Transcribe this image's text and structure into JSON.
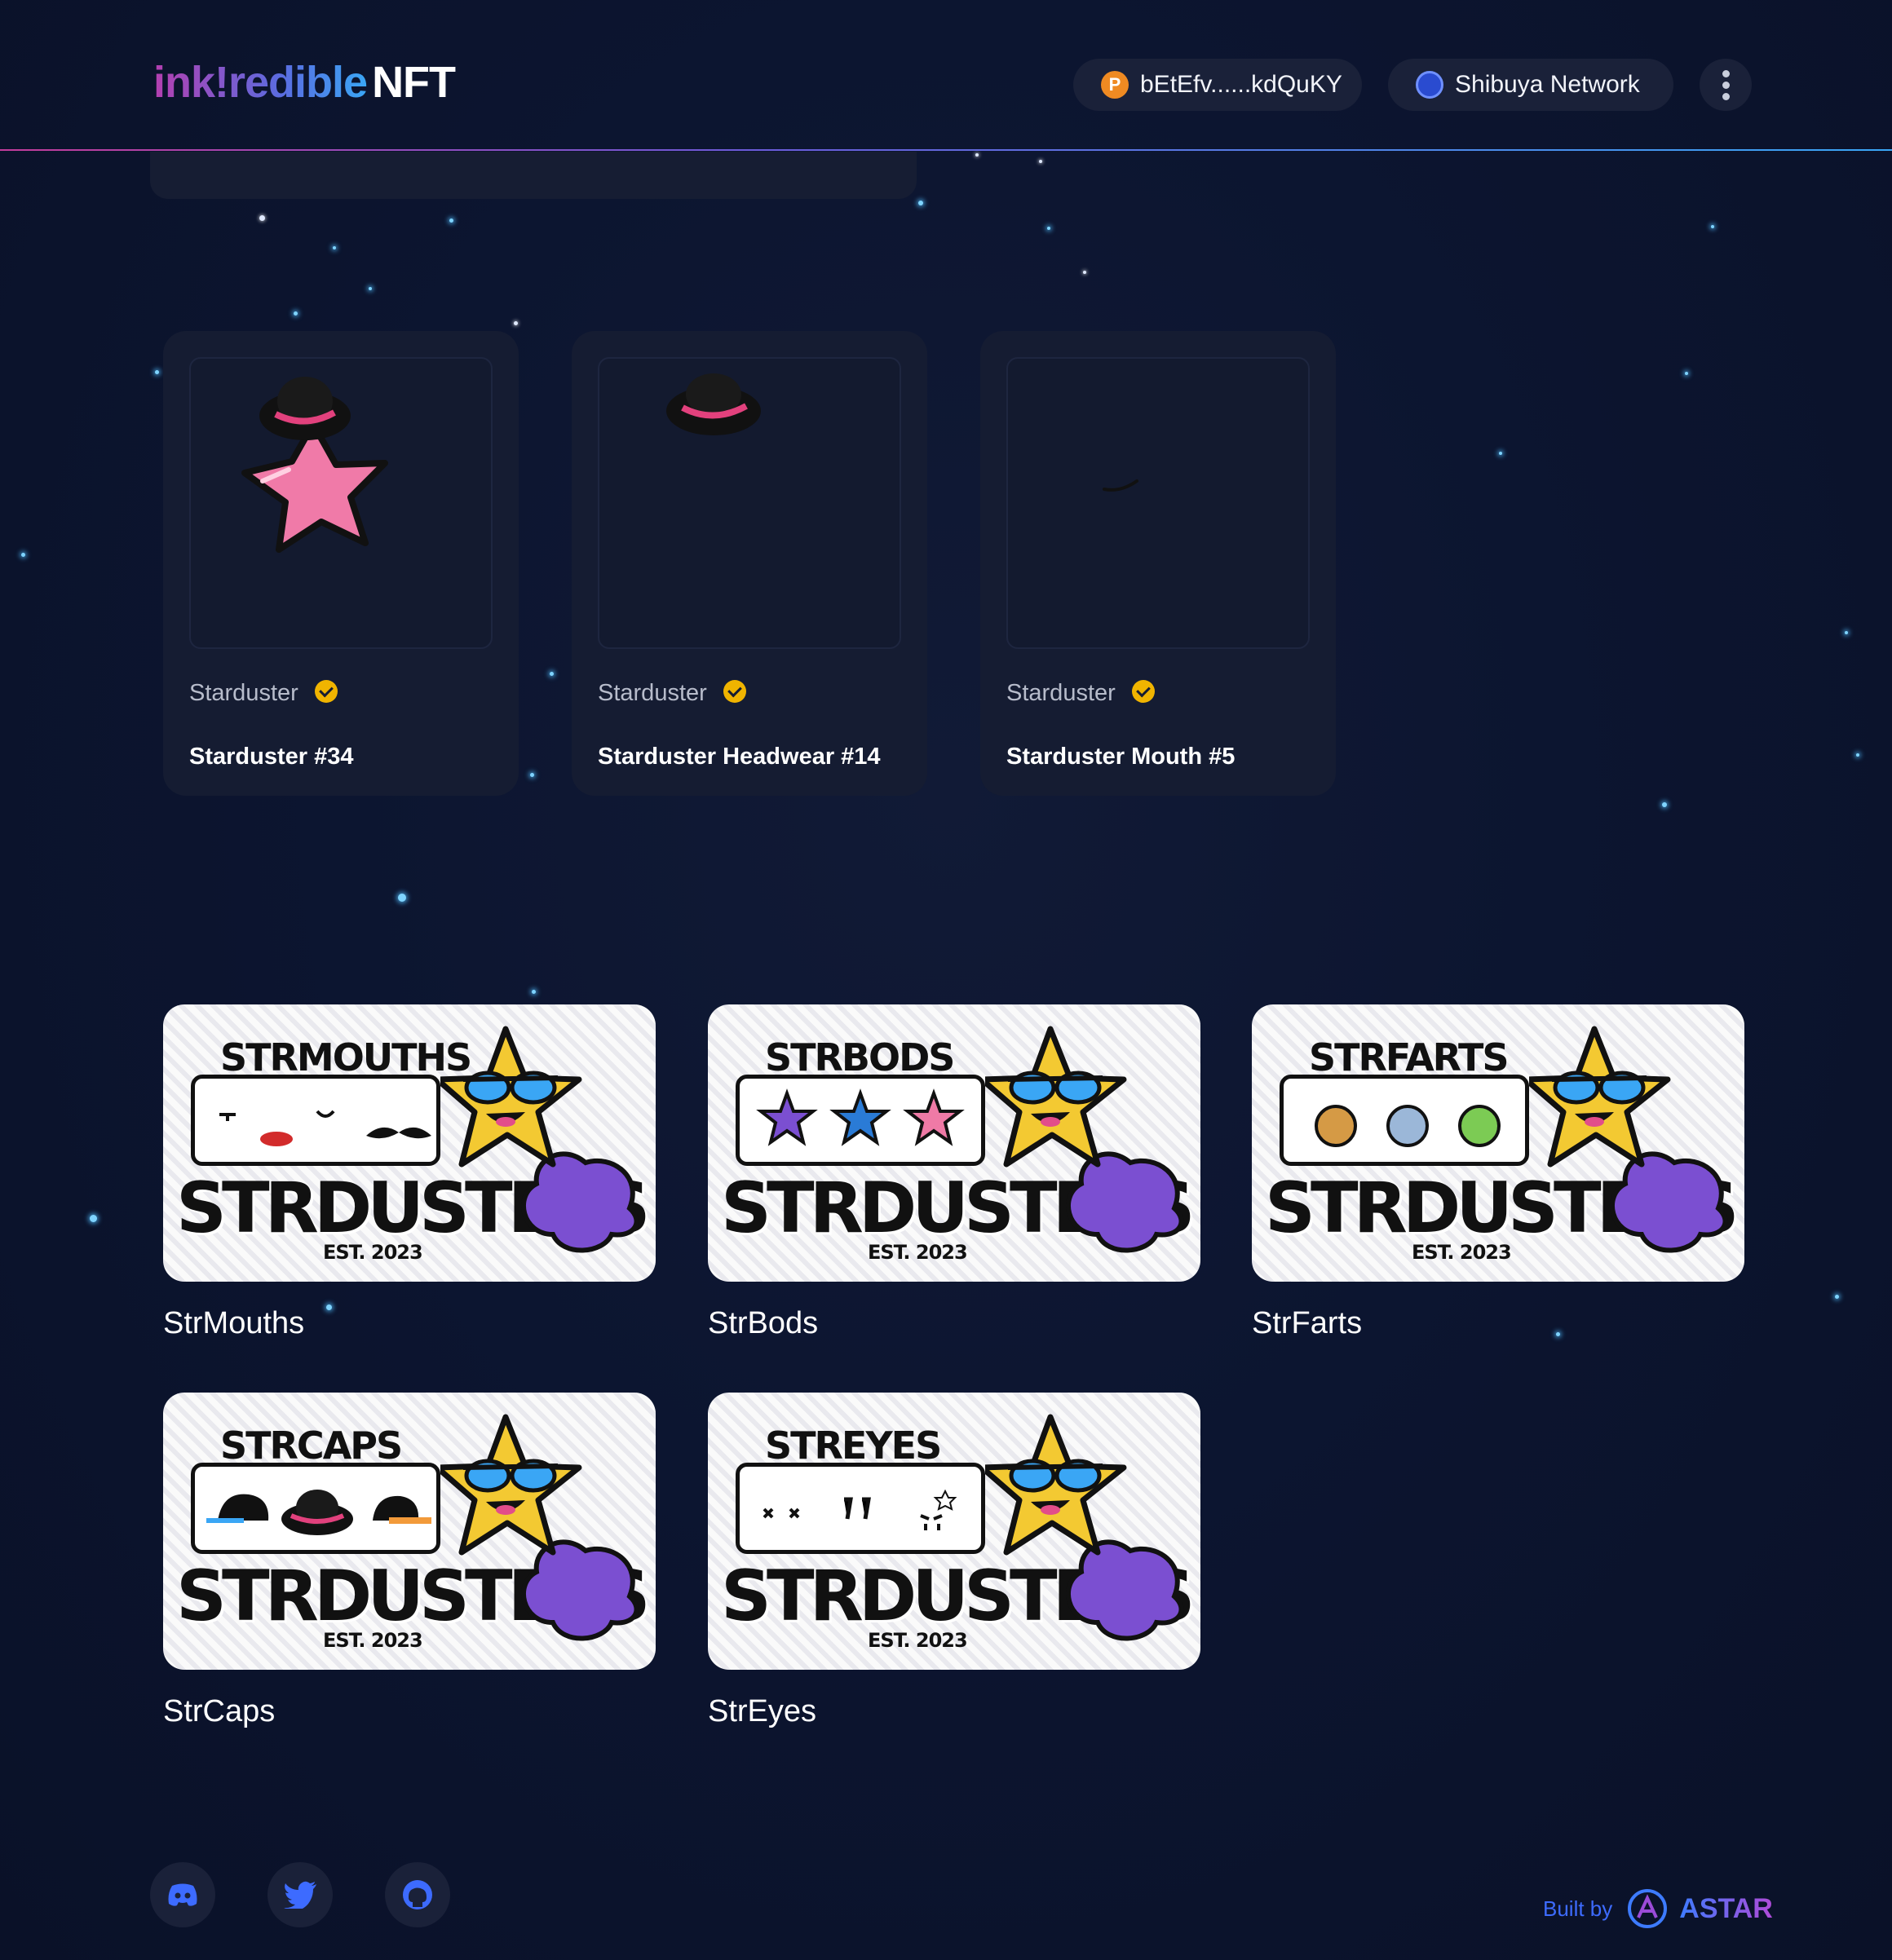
{
  "header": {
    "logo_part1": "ink!redible",
    "logo_part2": "NFT",
    "account": "bEtEfv......kdQuKY",
    "account_icon": "polkadot-icon",
    "network": "Shibuya Network",
    "network_icon": "shibuya-icon",
    "menu_icon": "more-vertical-icon"
  },
  "nfts": [
    {
      "collection": "Starduster",
      "name": "Starduster #34",
      "image": "pink-star-with-hat"
    },
    {
      "collection": "Starduster",
      "name": "Starduster Headwear #14",
      "image": "black-hat"
    },
    {
      "collection": "Starduster",
      "name": "Starduster Mouth #5",
      "image": "mouth-line"
    }
  ],
  "collections": [
    {
      "name": "StrMouths",
      "banner_title": "STRMOUTHS",
      "banner_brand": "STRDUSTERS",
      "banner_est": "EST. 2023"
    },
    {
      "name": "StrBods",
      "banner_title": "STRBODS",
      "banner_brand": "STRDUSTERS",
      "banner_est": "EST. 2023"
    },
    {
      "name": "StrFarts",
      "banner_title": "STRFARTS",
      "banner_brand": "STRDUSTERS",
      "banner_est": "EST. 2023"
    },
    {
      "name": "StrCaps",
      "banner_title": "STRCAPS",
      "banner_brand": "STRDUSTERS",
      "banner_est": "EST. 2023"
    },
    {
      "name": "StrEyes",
      "banner_title": "STREYES",
      "banner_brand": "STRDUSTERS",
      "banner_est": "EST. 2023"
    }
  ],
  "footer": {
    "social": [
      "discord-icon",
      "twitter-icon",
      "github-icon"
    ],
    "built_by": "Built by",
    "brand": "ASTAR"
  },
  "colors": {
    "background": "#0b1330",
    "card": "#151c32",
    "verified": "#f0b400",
    "accent_blue": "#3d6bff"
  }
}
